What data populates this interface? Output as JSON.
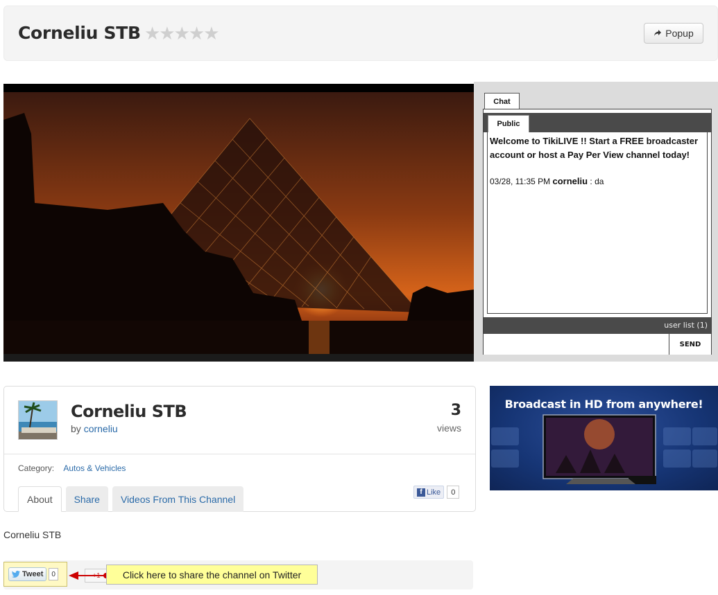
{
  "header": {
    "title": "Corneliu STB",
    "rating_stars": "★★★★★",
    "popup_label": "Popup"
  },
  "chat": {
    "tab_label": "Chat",
    "subtab_label": "Public",
    "welcome": "Welcome to TikiLIVE !! Start a FREE broadcaster account or host a Pay Per View channel today!",
    "messages": [
      {
        "time": "03/28, 11:35 PM",
        "user": "corneliu",
        "sep": " : ",
        "text": "da"
      }
    ],
    "user_list": "user list (1)",
    "send_label": "SEND",
    "input_value": ""
  },
  "channel": {
    "title": "Corneliu STB",
    "by_prefix": "by",
    "author": "corneliu",
    "views_count": "3",
    "views_label": "views",
    "category_label": "Category:",
    "category_value": "Autos & Vehicles",
    "tabs": [
      "About",
      "Share",
      "Videos From This Channel"
    ],
    "fb_like_label": "Like",
    "fb_like_count": "0"
  },
  "ad": {
    "headline": "Broadcast in HD from anywhere!"
  },
  "description": "Corneliu STB",
  "share": {
    "tweet_label": "Tweet",
    "tweet_count": "0",
    "gplus_label": "+1",
    "callout_text": "Click here to share the channel on Twitter"
  },
  "colors": {
    "link": "#2a6aa8",
    "callout_bg": "#ffff99",
    "chat_bar": "#4a4a4a",
    "ad_bg": "#163575"
  },
  "icons": {
    "popup": "share-arrow-icon",
    "tweet": "twitter-bird-icon",
    "like": "facebook-icon",
    "gplus": "google-plus-icon",
    "callout": "red-arrow-icon"
  }
}
